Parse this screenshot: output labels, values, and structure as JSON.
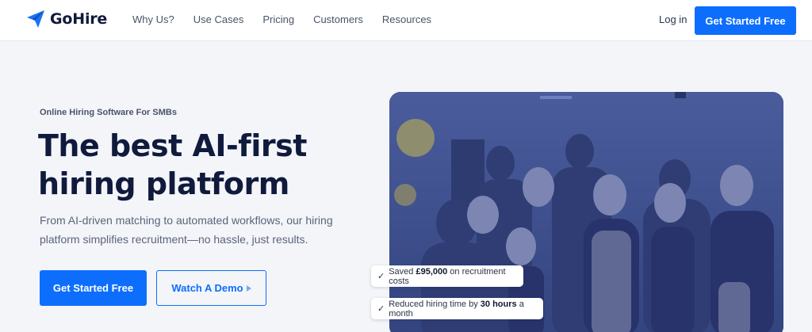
{
  "brand": {
    "name": "GoHire",
    "accent": "#0d6efd"
  },
  "nav": {
    "items": [
      "Why Us?",
      "Use Cases",
      "Pricing",
      "Customers",
      "Resources"
    ],
    "login": "Log in",
    "cta": "Get Started Free"
  },
  "hero": {
    "eyebrow": "Online Hiring Software For SMBs",
    "headline_line1": "The best AI-first",
    "headline_line2": "hiring platform",
    "subtext": "From AI-driven matching to automated workflows, our hiring platform simplifies recruitment—no hassle, just results.",
    "primary_cta": "Get Started Free",
    "secondary_cta": "Watch A Demo"
  },
  "stats": [
    {
      "prefix": "Saved ",
      "highlight": "£95,000",
      "suffix": " on recruitment costs"
    },
    {
      "prefix": "Reduced hiring time by ",
      "highlight": "30 hours",
      "suffix": " a month"
    }
  ],
  "icons": {
    "logo": "paper-plane-icon",
    "play": "play-icon",
    "check": "check-icon"
  }
}
